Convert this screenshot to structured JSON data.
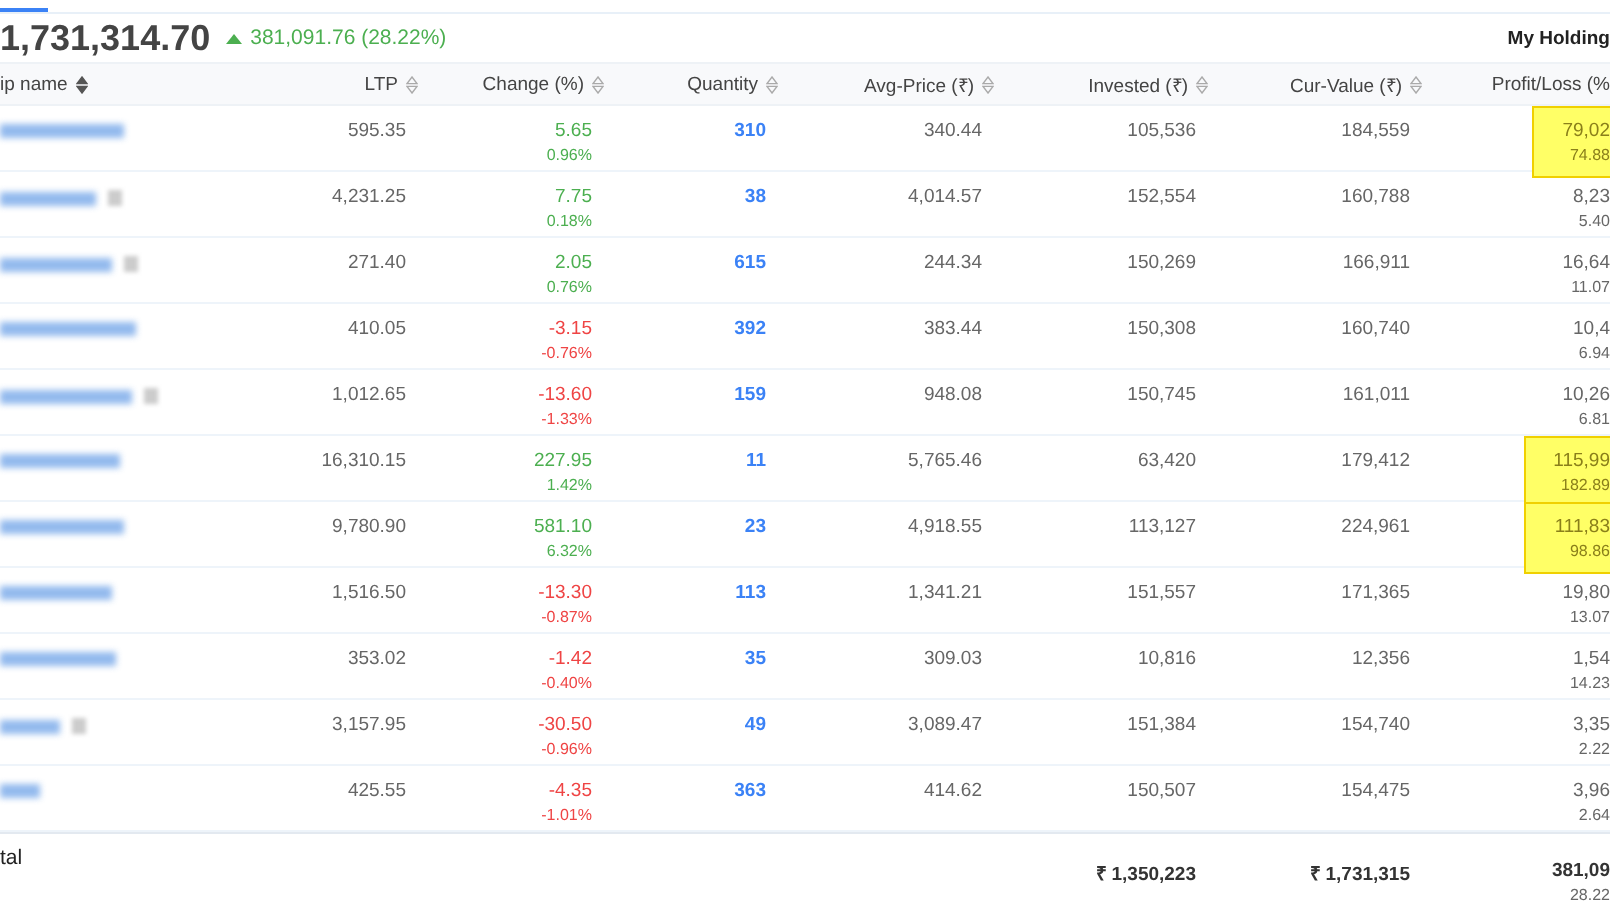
{
  "header": {
    "total_value": "1,731,314.70",
    "change": "381,091.76 (28.22%)",
    "link": "My Holding"
  },
  "table": {
    "columns": [
      {
        "label": "ip name",
        "sorted": true
      },
      {
        "label": "LTP",
        "sorted": false
      },
      {
        "label": "Change (%)",
        "sorted": false
      },
      {
        "label": "Quantity",
        "sorted": false
      },
      {
        "label": "Avg-Price (₹)",
        "sorted": false
      },
      {
        "label": "Invested (₹)",
        "sorted": false
      },
      {
        "label": "Cur-Value (₹)",
        "sorted": false
      },
      {
        "label": "Profit/Loss (%"
      }
    ],
    "rows": [
      {
        "ltp": "595.35",
        "change": "5.65",
        "change_pct": "0.96%",
        "color": "#4caf50",
        "quantity": "310",
        "avg_price": "340.44",
        "invested": "105,536",
        "cur_value": "184,559",
        "pl": "79,02",
        "pl_pct": "74.88",
        "highlighted": true
      },
      {
        "ltp": "4,231.25",
        "change": "7.75",
        "change_pct": "0.18%",
        "color": "#4caf50",
        "quantity": "38",
        "avg_price": "4,014.57",
        "invested": "152,554",
        "cur_value": "160,788",
        "pl": "8,23",
        "pl_pct": "5.40",
        "highlighted": false
      },
      {
        "ltp": "271.40",
        "change": "2.05",
        "change_pct": "0.76%",
        "color": "#4caf50",
        "quantity": "615",
        "avg_price": "244.34",
        "invested": "150,269",
        "cur_value": "166,911",
        "pl": "16,64",
        "pl_pct": "11.07",
        "highlighted": false
      },
      {
        "ltp": "410.05",
        "change": "-3.15",
        "change_pct": "-0.76%",
        "color": "#ef4444",
        "quantity": "392",
        "avg_price": "383.44",
        "invested": "150,308",
        "cur_value": "160,740",
        "pl": "10,4",
        "pl_pct": "6.94",
        "highlighted": false
      },
      {
        "ltp": "1,012.65",
        "change": "-13.60",
        "change_pct": "-1.33%",
        "color": "#ef4444",
        "quantity": "159",
        "avg_price": "948.08",
        "invested": "150,745",
        "cur_value": "161,011",
        "pl": "10,26",
        "pl_pct": "6.81",
        "highlighted": false
      },
      {
        "ltp": "16,310.15",
        "change": "227.95",
        "change_pct": "1.42%",
        "color": "#4caf50",
        "quantity": "11",
        "avg_price": "5,765.46",
        "invested": "63,420",
        "cur_value": "179,412",
        "pl": "115,99",
        "pl_pct": "182.89",
        "highlighted": true
      },
      {
        "ltp": "9,780.90",
        "change": "581.10",
        "change_pct": "6.32%",
        "color": "#4caf50",
        "quantity": "23",
        "avg_price": "4,918.55",
        "invested": "113,127",
        "cur_value": "224,961",
        "pl": "111,83",
        "pl_pct": "98.86",
        "highlighted": true
      },
      {
        "ltp": "1,516.50",
        "change": "-13.30",
        "change_pct": "-0.87%",
        "color": "#ef4444",
        "quantity": "113",
        "avg_price": "1,341.21",
        "invested": "151,557",
        "cur_value": "171,365",
        "pl": "19,80",
        "pl_pct": "13.07",
        "highlighted": false
      },
      {
        "ltp": "353.02",
        "change": "-1.42",
        "change_pct": "-0.40%",
        "color": "#ef4444",
        "quantity": "35",
        "avg_price": "309.03",
        "invested": "10,816",
        "cur_value": "12,356",
        "pl": "1,54",
        "pl_pct": "14.23",
        "highlighted": false
      },
      {
        "ltp": "3,157.95",
        "change": "-30.50",
        "change_pct": "-0.96%",
        "color": "#ef4444",
        "quantity": "49",
        "avg_price": "3,089.47",
        "invested": "151,384",
        "cur_value": "154,740",
        "pl": "3,35",
        "pl_pct": "2.22",
        "highlighted": false
      },
      {
        "ltp": "425.55",
        "change": "-4.35",
        "change_pct": "-1.01%",
        "color": "#ef4444",
        "quantity": "363",
        "avg_price": "414.62",
        "invested": "150,507",
        "cur_value": "154,475",
        "pl": "3,96",
        "pl_pct": "2.64",
        "highlighted": false
      }
    ],
    "total": {
      "label": "tal",
      "invested": "₹ 1,350,223",
      "cur_value": "₹ 1,731,315",
      "pl": "381,09",
      "pl_pct": "28.22"
    }
  }
}
